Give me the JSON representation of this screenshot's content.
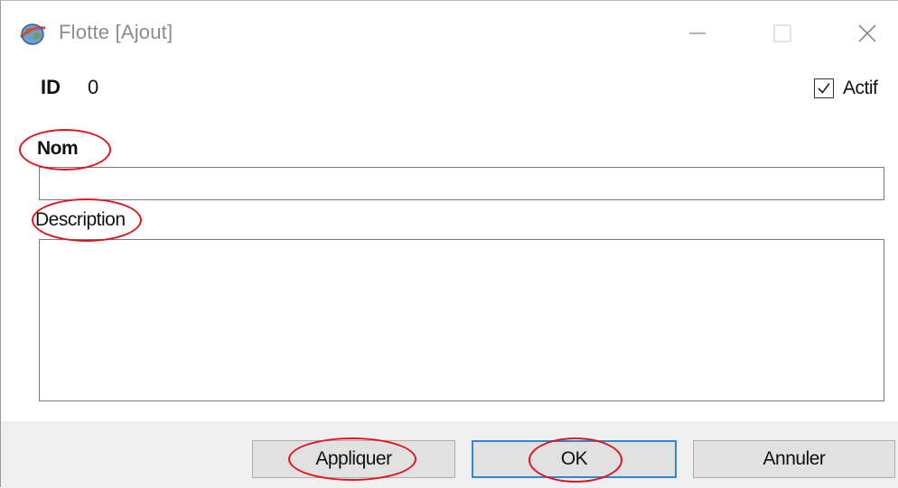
{
  "window": {
    "title": "Flotte [Ajout]",
    "icon": "globe-app-icon"
  },
  "title_controls": {
    "minimize_icon": "minimize-icon",
    "maximize_icon": "maximize-icon",
    "close_icon": "close-icon"
  },
  "form": {
    "id_label": "ID",
    "id_value": "0",
    "actif_label": "Actif",
    "actif_checked": true,
    "nom_label": "Nom",
    "nom_value": "",
    "description_label": "Description",
    "description_value": ""
  },
  "buttons": {
    "apply_label": "Appliquer",
    "ok_label": "OK",
    "cancel_label": "Annuler"
  },
  "colors": {
    "annotation": "#e0141e",
    "default_button_border": "#2f86d6",
    "footer_background": "#f0f0f0"
  }
}
